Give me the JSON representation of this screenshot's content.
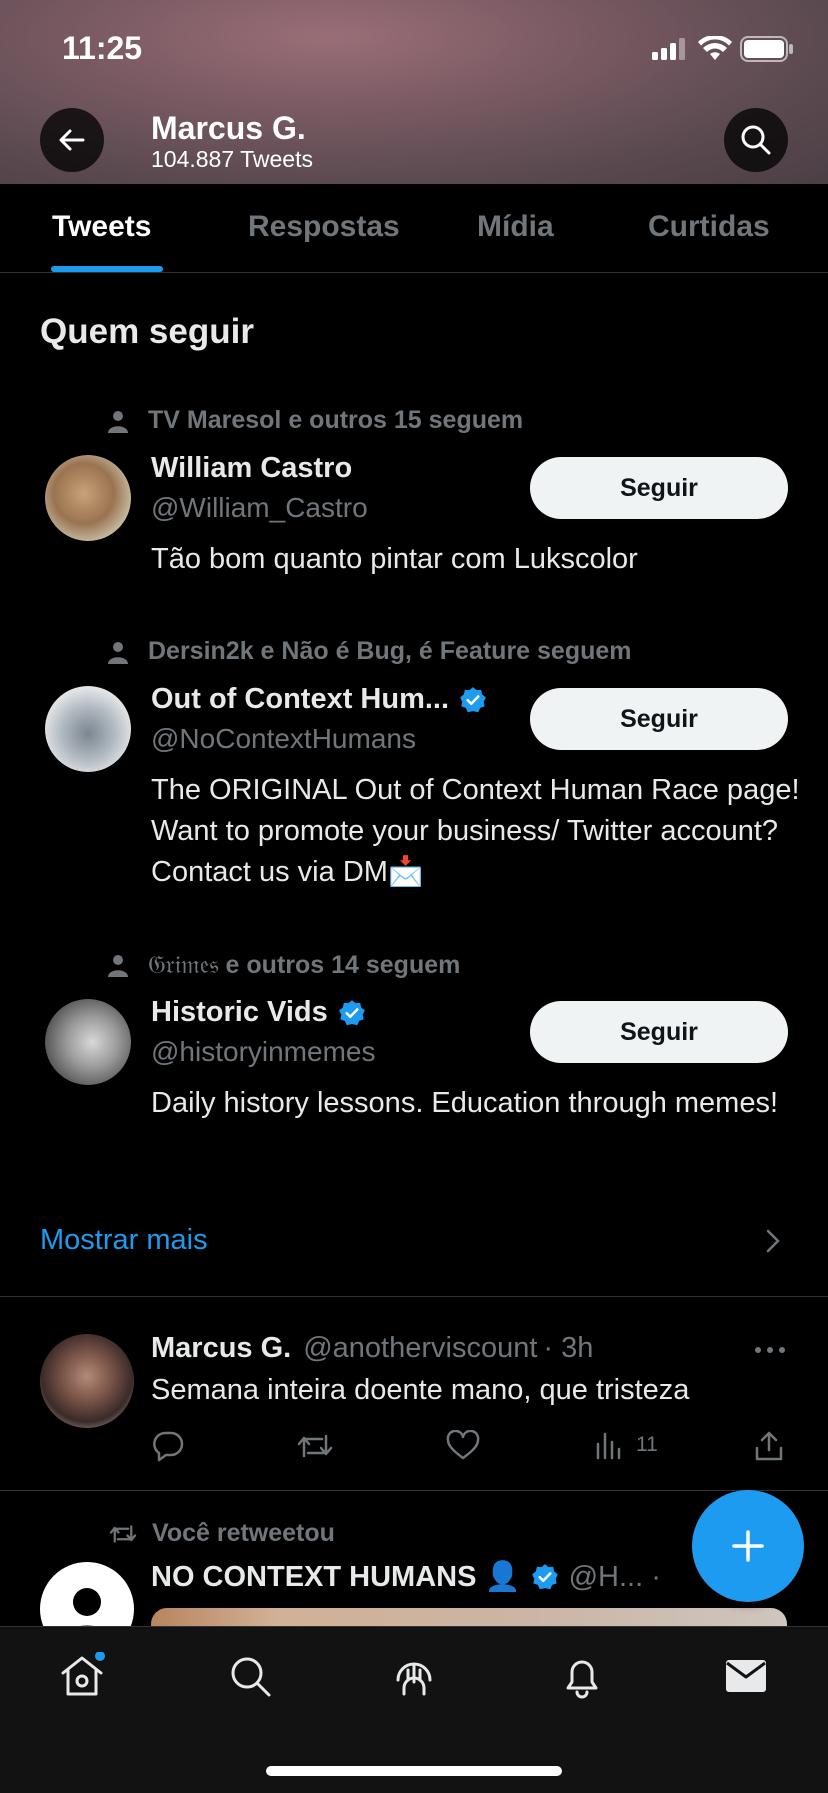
{
  "status_bar": {
    "time": "11:25"
  },
  "header": {
    "name": "Marcus G.",
    "tweet_count": "104.887 Tweets"
  },
  "tabs": [
    {
      "label": "Tweets",
      "active": true
    },
    {
      "label": "Respostas",
      "active": false
    },
    {
      "label": "Mídia",
      "active": false
    },
    {
      "label": "Curtidas",
      "active": false
    }
  ],
  "who_to_follow": {
    "title": "Quem seguir",
    "follow_label": "Seguir",
    "show_more": "Mostrar mais",
    "users": [
      {
        "context": "TV Maresol e outros 15 seguem",
        "name": "William Castro",
        "handle": "@William_Castro",
        "verified": false,
        "bio": "Tão bom quanto pintar com Lukscolor"
      },
      {
        "context": "Dersin2k e Não é Bug, é Feature seguem",
        "name": "Out of Context Hum...",
        "handle": "@NoContextHumans",
        "verified": true,
        "bio": "The ORIGINAL Out of Context Human Race page! Want to promote your business/ Twitter account? Contact us via DM📩"
      },
      {
        "context_name": "𝔊𝔯𝔦𝔪𝔢𝔰",
        "context": " e outros 14 seguem",
        "name": "Historic Vids",
        "handle": "@historyinmemes",
        "verified": true,
        "bio": "Daily history lessons. Education through memes!"
      }
    ]
  },
  "tweet": {
    "name": "Marcus G.",
    "handle": "@anotherviscount",
    "time": "· 3h",
    "text": "Semana inteira doente mano, que tristeza",
    "views": "11"
  },
  "retweet": {
    "context": "Você retweetou",
    "name": "NO CONTEXT HUMANS 👤",
    "handle": "@H... ·"
  },
  "colors": {
    "accent": "#1d9bf0",
    "background": "#000000",
    "muted": "#71767b"
  }
}
